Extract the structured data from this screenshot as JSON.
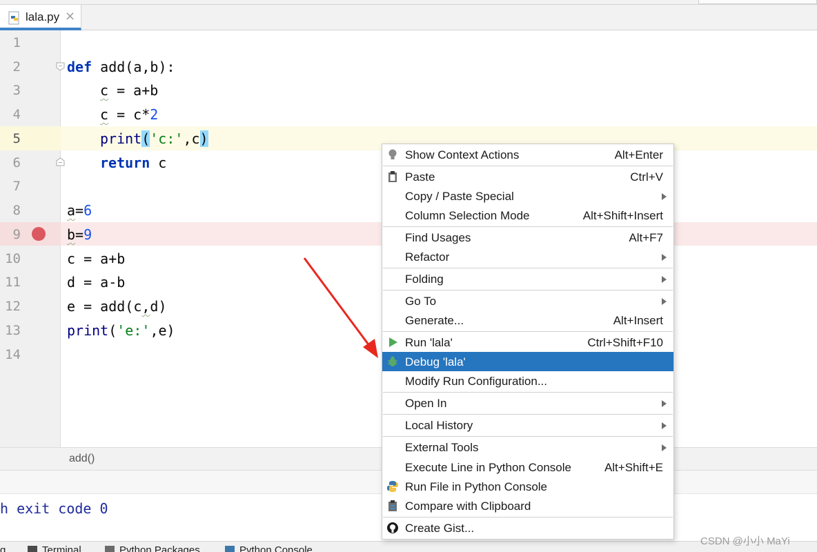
{
  "tab": {
    "filename": "lala.py",
    "close_glyph": "×"
  },
  "gutter": {
    "line_numbers": [
      "1",
      "2",
      "3",
      "4",
      "5",
      "6",
      "7",
      "8",
      "9",
      "10",
      "11",
      "12",
      "13",
      "14"
    ]
  },
  "code": {
    "l2": {
      "def": "def",
      "rest": " add(a,b):"
    },
    "l3": {
      "c": "c",
      "rest": " = a+b"
    },
    "l4": {
      "c": "c",
      "rest": " = c*",
      "num": "2"
    },
    "l5": {
      "print": "print",
      "lp": "(",
      "str": "'c:'",
      "mid": ",c",
      "rp": ")"
    },
    "l6": {
      "ret": "return",
      "rest": " c"
    },
    "l8": {
      "a": "a",
      "eq": "=",
      "num": "6"
    },
    "l9": {
      "b": "b",
      "eq": "=",
      "num": "9"
    },
    "l10": "c = a+b",
    "l11": "d = a-b",
    "l12": {
      "pre": "e = add(c",
      "sep": ",",
      "post": "d)"
    },
    "l13": {
      "print": "print",
      "lp": "(",
      "str": "'e:'",
      "mid": ",e)"
    }
  },
  "breadcrumb": {
    "item": "add()"
  },
  "console": {
    "line": "h exit code 0"
  },
  "toolwindows": {
    "t1": "Terminal",
    "t2": "Python Packages",
    "t3": "Python Console",
    "t0": "g"
  },
  "watermark": "CSDN @小小 MaYi",
  "menu": {
    "show_context": {
      "label": "Show Context Actions",
      "shortcut": "Alt+Enter"
    },
    "paste": {
      "label": "Paste",
      "shortcut": "Ctrl+V"
    },
    "copy_paste_special": {
      "label": "Copy / Paste Special"
    },
    "column_selection": {
      "label": "Column Selection Mode",
      "shortcut": "Alt+Shift+Insert"
    },
    "find_usages": {
      "label": "Find Usages",
      "shortcut": "Alt+F7"
    },
    "refactor": {
      "label": "Refactor"
    },
    "folding": {
      "label": "Folding"
    },
    "go_to": {
      "label": "Go To"
    },
    "generate": {
      "label": "Generate...",
      "shortcut": "Alt+Insert"
    },
    "run": {
      "label": "Run 'lala'",
      "shortcut": "Ctrl+Shift+F10"
    },
    "debug": {
      "label": "Debug 'lala'"
    },
    "modify_run": {
      "label": "Modify Run Configuration..."
    },
    "open_in": {
      "label": "Open In"
    },
    "local_history": {
      "label": "Local History"
    },
    "external_tools": {
      "label": "External Tools"
    },
    "execute_line": {
      "label": "Execute Line in Python Console",
      "shortcut": "Alt+Shift+E"
    },
    "run_file_console": {
      "label": "Run File in Python Console"
    },
    "compare_clipboard": {
      "label": "Compare with Clipboard"
    },
    "create_gist": {
      "label": "Create Gist..."
    }
  },
  "colors": {
    "keyword": "#0033b3",
    "number": "#1750eb",
    "string": "#067d17",
    "breakpoint": "#db5860",
    "selection": "#2675bf",
    "annotation_arrow": "#e8281f"
  }
}
